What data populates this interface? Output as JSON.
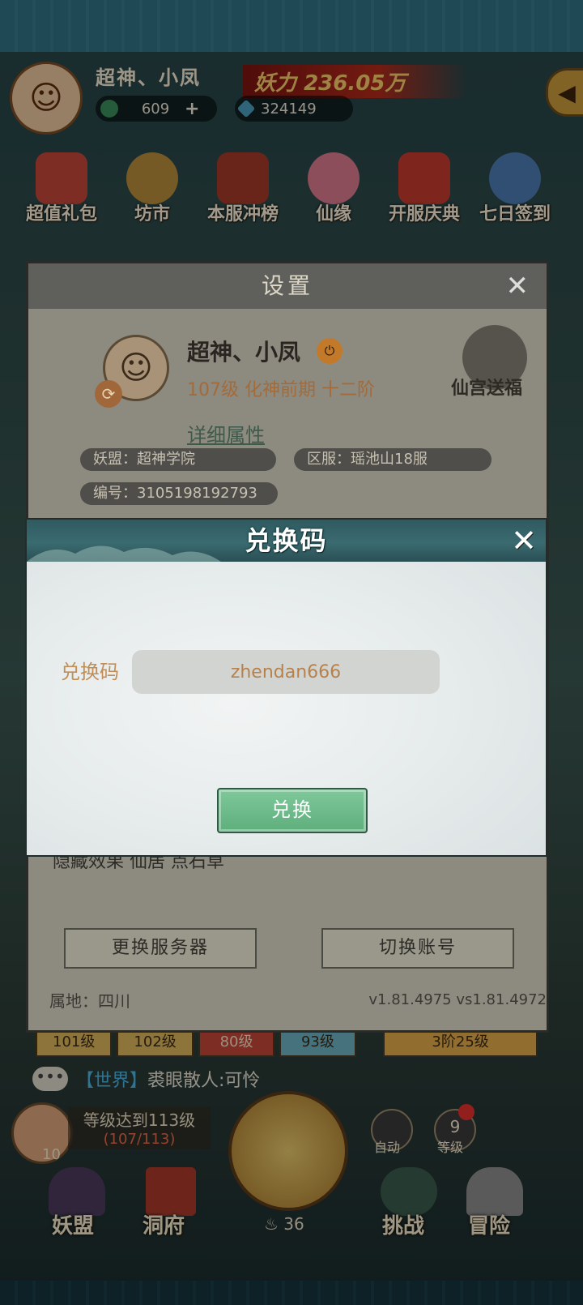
{
  "header": {
    "player_name": "超神、小凤",
    "power_label": "妖力",
    "power_value": "236.05万",
    "currency_jade": "609",
    "currency_plus": "+",
    "currency_crystal": "324149"
  },
  "menu": {
    "items": [
      {
        "label": "超值礼包",
        "icon": "gift-bag-icon",
        "color": "#c2463a"
      },
      {
        "label": "坊市",
        "icon": "market-coin-icon",
        "color": "#b58a3a"
      },
      {
        "label": "本服冲榜",
        "icon": "ranking-gate-icon",
        "color": "#a33a2a"
      },
      {
        "label": "仙缘",
        "icon": "lotus-icon",
        "color": "#d8788a"
      },
      {
        "label": "开服庆典",
        "icon": "gift-box-icon",
        "color": "#c23a2f"
      },
      {
        "label": "七日签到",
        "icon": "globe-icon",
        "color": "#4a7ab0"
      }
    ]
  },
  "settings": {
    "title": "设置",
    "name": "超神、小凤",
    "level_text": "107级 化神前期 十二阶",
    "xian_label": "仙宫送福",
    "details_link": "详细属性",
    "guild": "妖盟：超神学院",
    "server": "区服：瑶池山18服",
    "id": "编号：3105198192793",
    "partial_row": "隐藏效果    仙居    点石草",
    "change_server": "更换服务器",
    "switch_account": "切换账号",
    "location": "属地：四川",
    "version": "v1.81.4975 vs1.81.4972"
  },
  "level_bar": {
    "chips": [
      "101级",
      "102级",
      "80级",
      "93级"
    ],
    "right": "3阶25级"
  },
  "chat": {
    "channel": "【世界】",
    "message": "裘眼散人:可怜"
  },
  "quest": {
    "title": "等级达到113级",
    "progress": "(107/113)",
    "count": "10",
    "auto_label": "自动",
    "level_label": "等级",
    "level_num": "9",
    "axe_count": "36"
  },
  "bottom_nav": {
    "items": [
      "妖盟",
      "洞府",
      "挑战",
      "冒险"
    ]
  },
  "dialog": {
    "title": "兑换码",
    "close": "✕",
    "field_label": "兑换码",
    "code_value": "zhendan666",
    "confirm_label": "兑换"
  }
}
